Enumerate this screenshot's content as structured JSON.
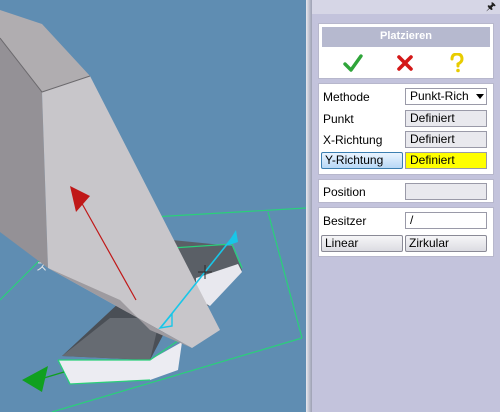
{
  "panel": {
    "title": "Platzieren",
    "header_icons": {
      "ok": "checkmark-icon",
      "cancel": "x-icon",
      "help": "question-icon",
      "pin": "pin-icon"
    },
    "rows": {
      "method_label": "Methode",
      "method_value": "Punkt-Rich",
      "point_label": "Punkt",
      "point_value": "Definiert",
      "xdir_label": "X-Richtung",
      "xdir_value": "Definiert",
      "ydir_label": "Y-Richtung",
      "ydir_value": "Definiert"
    },
    "position_label": "Position",
    "position_value": "",
    "owner_label": "Besitzer",
    "owner_value": "/",
    "linear_label": "Linear",
    "circular_label": "Zirkular"
  },
  "colors": {
    "viewport_bg": "#5f8db2",
    "highlight_yellow": "#ffff00",
    "ok_green": "#2fa53a",
    "cancel_red": "#d41818",
    "help_yellow": "#e8cc00",
    "axis_red": "#c01818",
    "axis_cyan": "#19c6e8",
    "axis_green": "#10a020",
    "grid_green": "#2ad07a"
  },
  "viewport": {
    "axis_label": "ス"
  }
}
